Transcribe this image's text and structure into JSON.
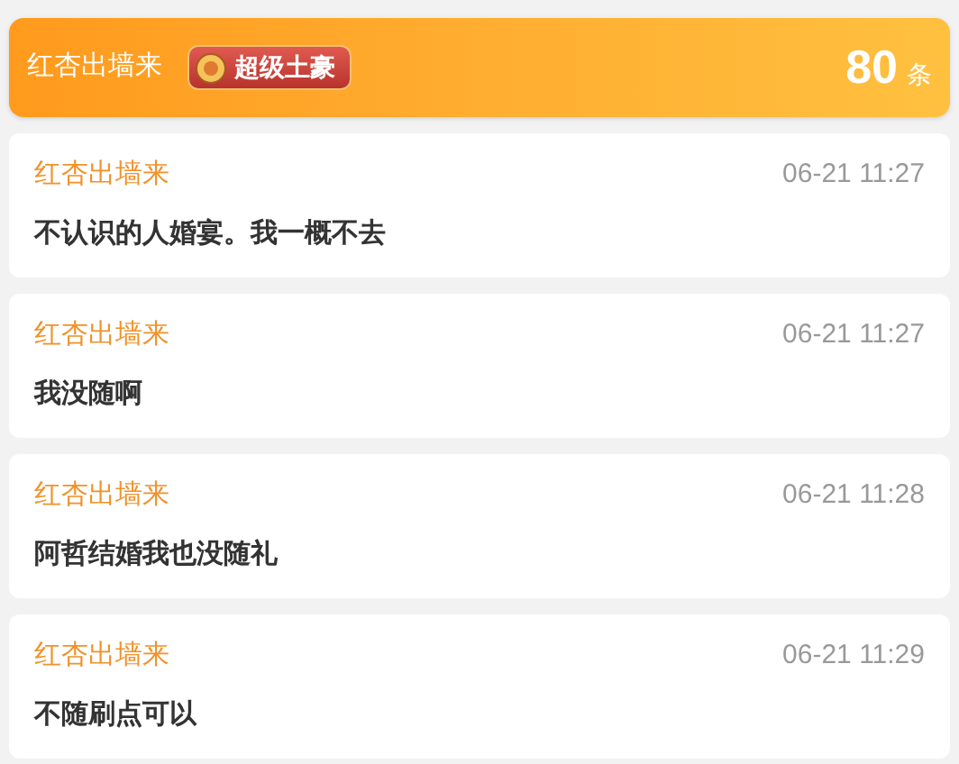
{
  "header": {
    "name": "红杏出墙来",
    "badge": "超级土豪",
    "count": "80",
    "unit": "条"
  },
  "messages": [
    {
      "sender": "红杏出墙来",
      "time": "06-21 11:27",
      "text": "不认识的人婚宴。我一概不去"
    },
    {
      "sender": "红杏出墙来",
      "time": "06-21 11:27",
      "text": "我没随啊"
    },
    {
      "sender": "红杏出墙来",
      "time": "06-21 11:28",
      "text": "阿哲结婚我也没随礼"
    },
    {
      "sender": "红杏出墙来",
      "time": "06-21 11:29",
      "text": "不随刷点可以"
    }
  ]
}
